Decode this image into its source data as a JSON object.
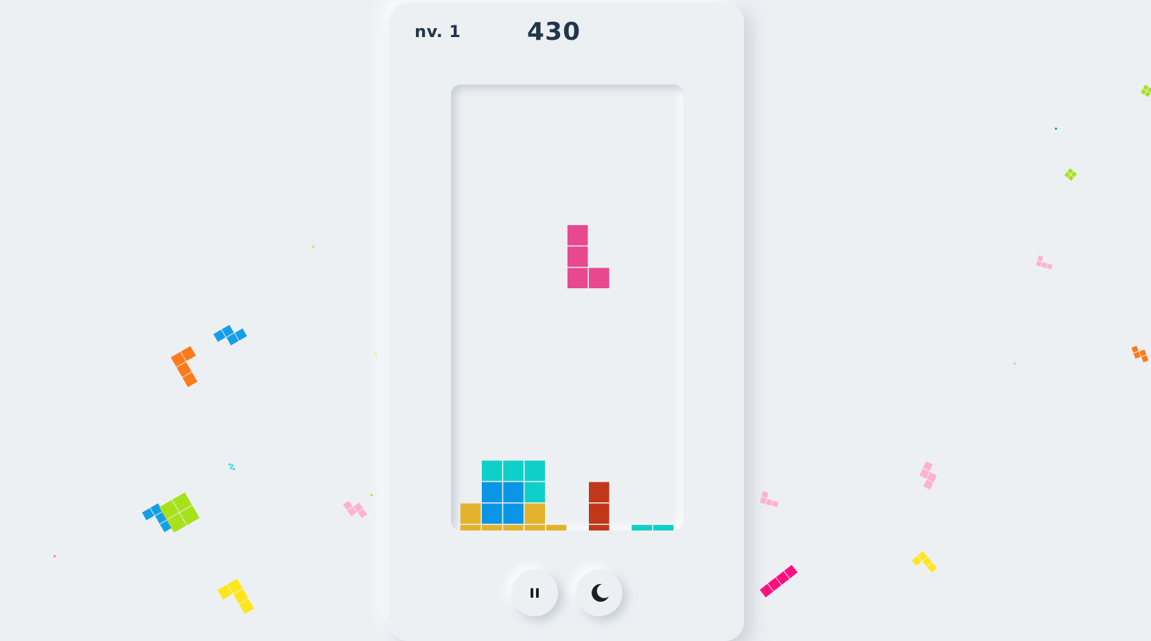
{
  "header": {
    "level_label": "nv. 1",
    "score": "430"
  },
  "controls": {
    "pause_icon": "pause-icon",
    "theme_icon": "moon-icon"
  },
  "board": {
    "columns": 10,
    "rows": 21,
    "colors": {
      "cyan": "#0fd0c8",
      "blue": "#0a95e6",
      "yellow": "#e3b22d",
      "red": "#c1371a",
      "pink": "#e8488e"
    },
    "active_piece": {
      "type": "L",
      "color": "pink",
      "cells": [
        [
          5,
          6
        ],
        [
          5,
          7
        ],
        [
          5,
          8
        ],
        [
          6,
          8
        ]
      ]
    },
    "settled": [
      [
        1,
        17,
        "cyan"
      ],
      [
        2,
        17,
        "cyan"
      ],
      [
        3,
        17,
        "cyan"
      ],
      [
        1,
        18,
        "blue"
      ],
      [
        2,
        18,
        "blue"
      ],
      [
        3,
        18,
        "cyan"
      ],
      [
        6,
        18,
        "red"
      ],
      [
        0,
        19,
        "yellow"
      ],
      [
        1,
        19,
        "blue"
      ],
      [
        2,
        19,
        "blue"
      ],
      [
        3,
        19,
        "yellow"
      ],
      [
        6,
        19,
        "red"
      ],
      [
        0,
        20,
        "yellow"
      ],
      [
        1,
        20,
        "yellow"
      ],
      [
        2,
        20,
        "yellow"
      ],
      [
        3,
        20,
        "yellow"
      ],
      [
        4,
        20,
        "yellow"
      ],
      [
        6,
        20,
        "red"
      ],
      [
        8,
        20,
        "cyan"
      ],
      [
        9,
        20,
        "cyan"
      ]
    ]
  },
  "background_pieces": [
    {
      "color": "#ff7a1a",
      "cells": [
        [
          0,
          0
        ],
        [
          1,
          0
        ],
        [
          0,
          1
        ],
        [
          0,
          2
        ]
      ]
    },
    {
      "color": "#159ee8",
      "cells": [
        [
          0,
          0
        ],
        [
          1,
          0
        ],
        [
          1,
          1
        ],
        [
          2,
          1
        ]
      ]
    },
    {
      "color": "#159ee8",
      "cells": [
        [
          0,
          0
        ],
        [
          1,
          0
        ],
        [
          1,
          1
        ],
        [
          1,
          2
        ]
      ]
    },
    {
      "color": "#a6e11a",
      "cells": [
        [
          0,
          0
        ],
        [
          1,
          0
        ],
        [
          0,
          1
        ],
        [
          1,
          1
        ]
      ]
    },
    {
      "color": "#ffe61a",
      "cells": [
        [
          0,
          0
        ],
        [
          1,
          0
        ],
        [
          1,
          1
        ],
        [
          1,
          2
        ]
      ]
    },
    {
      "color": "#ffb3cf",
      "cells": [
        [
          0,
          0
        ],
        [
          0,
          1
        ],
        [
          1,
          1
        ],
        [
          1,
          2
        ]
      ]
    },
    {
      "color": "#ff0f7e",
      "cells": [
        [
          0,
          0
        ],
        [
          1,
          0
        ],
        [
          2,
          0
        ],
        [
          3,
          0
        ]
      ]
    },
    {
      "color": "#ffb3cf",
      "cells": [
        [
          0,
          0
        ],
        [
          0,
          1
        ],
        [
          1,
          1
        ],
        [
          1,
          2
        ]
      ]
    },
    {
      "color": "#ffe61a",
      "cells": [
        [
          0,
          0
        ],
        [
          1,
          0
        ],
        [
          1,
          1
        ],
        [
          1,
          2
        ]
      ]
    },
    {
      "color": "#ffb3cf",
      "cells": [
        [
          0,
          0
        ],
        [
          0,
          1
        ],
        [
          1,
          1
        ],
        [
          2,
          1
        ]
      ]
    },
    {
      "color": "#ffb3cf",
      "cells": [
        [
          0,
          0
        ],
        [
          0,
          1
        ],
        [
          1,
          1
        ],
        [
          2,
          1
        ]
      ]
    },
    {
      "color": "#ff7a1a",
      "cells": [
        [
          0,
          0
        ],
        [
          0,
          1
        ],
        [
          1,
          1
        ],
        [
          1,
          2
        ]
      ]
    },
    {
      "color": "#a6e11a",
      "cells": [
        [
          0,
          0
        ],
        [
          1,
          0
        ],
        [
          0,
          1
        ],
        [
          1,
          1
        ]
      ]
    },
    {
      "color": "#a6e11a",
      "cells": [
        [
          0,
          0
        ],
        [
          1,
          0
        ],
        [
          0,
          1
        ],
        [
          1,
          1
        ]
      ]
    },
    {
      "color": "#1fe0e0",
      "cells": [
        [
          0,
          0
        ],
        [
          1,
          0
        ],
        [
          1,
          1
        ],
        [
          2,
          1
        ]
      ]
    }
  ]
}
